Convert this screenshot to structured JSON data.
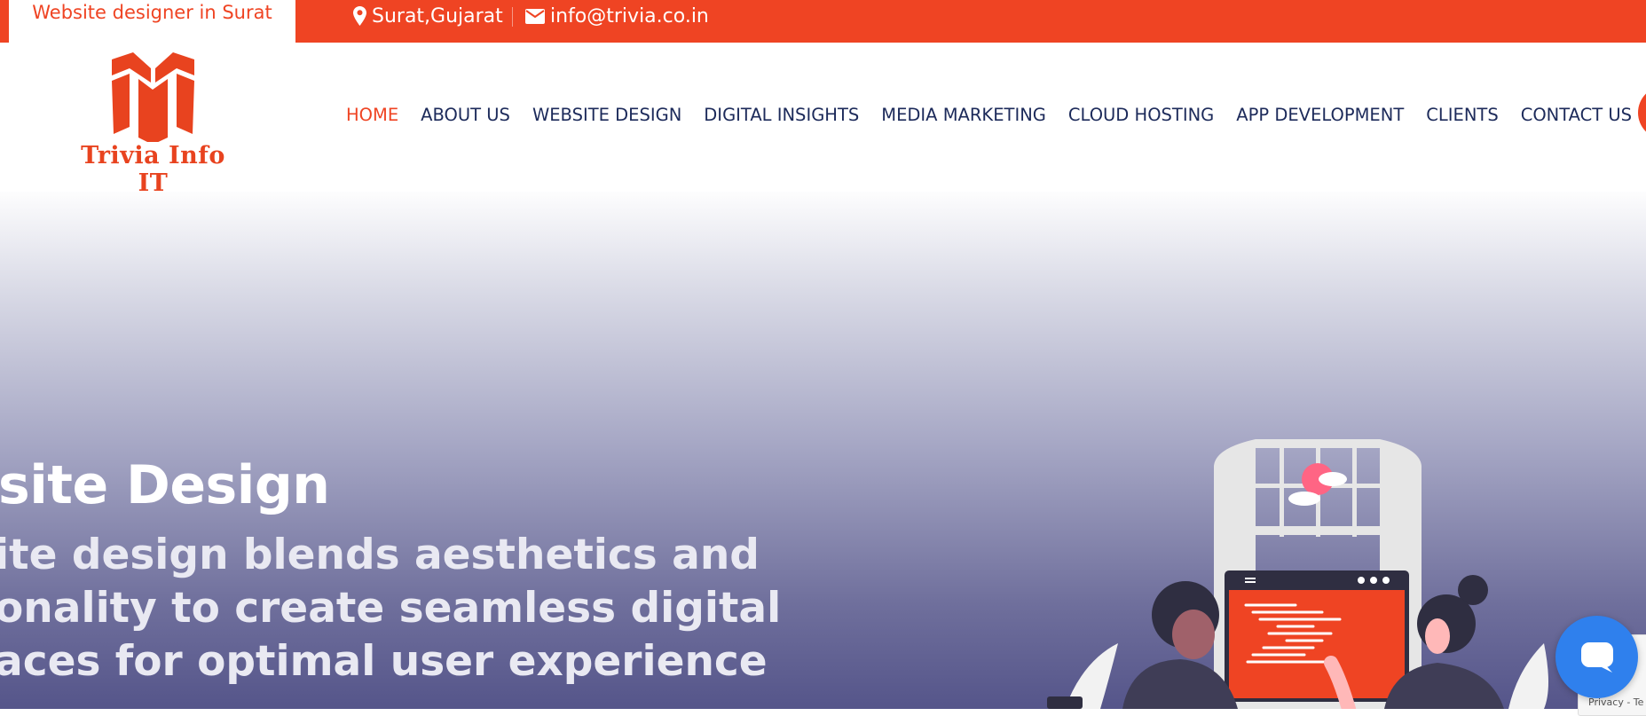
{
  "topbar": {
    "tagline": "Website designer in Surat",
    "location": "Surat,Gujarat",
    "email": "info@trivia.co.in",
    "bg_color": "#ef4423"
  },
  "brand": {
    "name": "Trivia Info IT",
    "color": "#e8431f"
  },
  "nav": {
    "items": [
      {
        "label": "HOME",
        "active": true
      },
      {
        "label": "ABOUT US"
      },
      {
        "label": "WEBSITE DESIGN"
      },
      {
        "label": "DIGITAL INSIGHTS"
      },
      {
        "label": "MEDIA MARKETING"
      },
      {
        "label": "CLOUD HOSTING"
      },
      {
        "label": "APP DEVELOPMENT"
      },
      {
        "label": "CLIENTS"
      },
      {
        "label": "CONTACT US"
      }
    ],
    "text_color": "#1c2a5a",
    "active_color": "#ef4423"
  },
  "hero": {
    "title": "site Design",
    "subtitle_lines": [
      "ite design blends aesthetics and",
      "onality to create seamless digital",
      "aces for optimal user experience"
    ]
  },
  "widgets": {
    "chat_icon": "chat-bubble-icon",
    "recaptcha_text": "Privacy - Te"
  }
}
